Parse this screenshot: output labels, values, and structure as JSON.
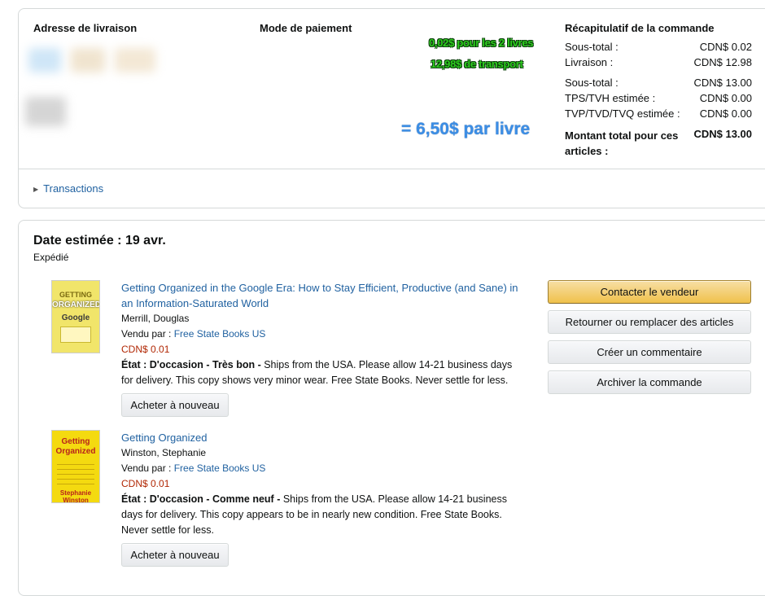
{
  "order_summary": {
    "address_header": "Adresse de livraison",
    "payment_header": "Mode de paiement",
    "recap_header": "Récapitulatif de la commande",
    "rows": [
      {
        "label": "Sous-total :",
        "value": "CDN$ 0.02"
      },
      {
        "label": "Livraison :",
        "value": "CDN$ 12.98"
      },
      {
        "label": "Sous-total :",
        "value": "CDN$ 13.00"
      },
      {
        "label": "TPS/TVH estimée :",
        "value": "CDN$ 0.00"
      },
      {
        "label": "TVP/TVD/TVQ estimée :",
        "value": "CDN$ 0.00"
      }
    ],
    "total_label_line1": "Montant total pour ces",
    "total_label_line2": "articles :",
    "total_value": "CDN$ 13.00",
    "transactions_label": "Transactions"
  },
  "annotations": {
    "line1": "0,02$ pour les 2 livres",
    "line2": "12,98$ de transport",
    "per_book": "= 6,50$ par livre",
    "green_color": "#2ecc1f",
    "blue_color": "#3b8ee6"
  },
  "shipment": {
    "date_title": "Date estimée : 19 avr.",
    "status": "Expédié",
    "items": [
      {
        "title_line1": "Getting Organized in the Google Era: How to Stay Efficient, Productive (and Sane) in",
        "title_line2": "an Information-Saturated World",
        "author": "Merrill, Douglas",
        "sold_by_label": "Vendu par : ",
        "seller": "Free State Books US",
        "price": "CDN$ 0.01",
        "condition_label": "État : D'occasion - Très bon -",
        "condition_text_line1": " Ships from the USA. Please allow 14-21 business days",
        "condition_text_line2": "for delivery. This copy shows very minor wear. Free State Books. Never settle for less.",
        "buy_again": "Acheter à nouveau",
        "cover_text": "GETTING ORGANIZED · Google",
        "cover_icon": "book-cover-google-era"
      },
      {
        "title_line1": "Getting Organized",
        "author": "Winston, Stephanie",
        "sold_by_label": "Vendu par : ",
        "seller": "Free State Books US",
        "price": "CDN$ 0.01",
        "condition_label": "État : D'occasion - Comme neuf -",
        "condition_text_line1": " Ships from the USA. Please allow 14-21 business",
        "condition_text_line2": "days for delivery. This copy appears to be in nearly new condition. Free State Books.",
        "condition_text_line3": "Never settle for less.",
        "buy_again": "Acheter à nouveau",
        "cover_text": "Getting Organized · Stephanie Winston",
        "cover_icon": "book-cover-getting-organized"
      }
    ],
    "actions": {
      "contact": "Contacter le vendeur",
      "return": "Retourner ou remplacer des articles",
      "review": "Créer un commentaire",
      "archive": "Archiver la commande"
    }
  }
}
